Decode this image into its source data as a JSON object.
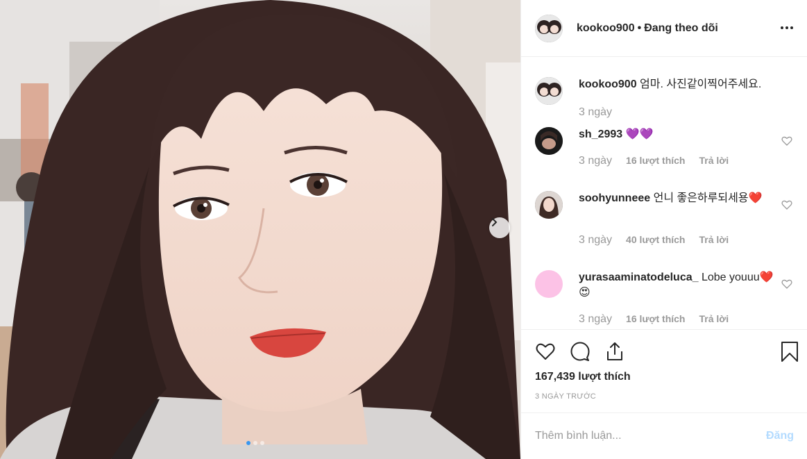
{
  "post": {
    "author": "kookoo900",
    "separator": "•",
    "follow_status": "Đang theo dõi",
    "more_icon": "more-horizontal-icon"
  },
  "carousel": {
    "current_index": 1,
    "total": 3
  },
  "comments": [
    {
      "user": "kookoo900",
      "text": "엄마. 사진같이찍어주세요.",
      "time": "3 ngày",
      "likes": "",
      "reply": ""
    },
    {
      "user": "sh_2993",
      "text": "💜💜",
      "time": "3 ngày",
      "likes": "16 lượt thích",
      "reply": "Trả lời"
    },
    {
      "user": "soohyunneee",
      "text": "언니 좋은하루되세용❤️",
      "time": "3 ngày",
      "likes": "40 lượt thích",
      "reply": "Trả lời"
    },
    {
      "user": "yurasaaminatodeluca_",
      "text": "Lobe youuu❤️😍",
      "time": "3 ngày",
      "likes": "16 lượt thích",
      "reply": "Trả lời"
    }
  ],
  "actions": {
    "like_icon": "heart-icon",
    "comment_icon": "comment-icon",
    "share_icon": "share-icon",
    "save_icon": "bookmark-icon"
  },
  "likes_total": "167,439 lượt thích",
  "timestamp": "3 NGÀY TRƯỚC",
  "add_comment": {
    "placeholder": "Thêm bình luận...",
    "post_label": "Đăng"
  },
  "colors": {
    "link_blue": "#3897f0",
    "post_disabled": "#b3dbff",
    "muted": "#999999",
    "text": "#262626"
  }
}
